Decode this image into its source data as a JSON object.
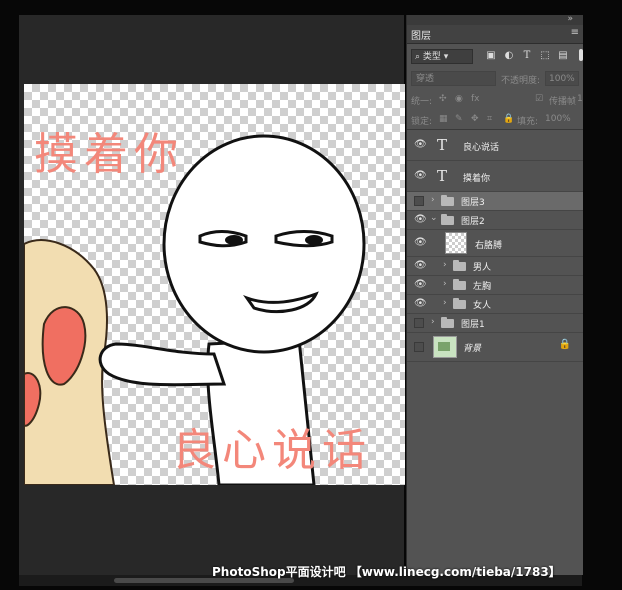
{
  "canvas": {
    "text_top": "摸着你",
    "text_bottom": "良心说话"
  },
  "layers_panel": {
    "tab_label": "图层",
    "filter_kind": "类型",
    "blend_mode": "穿透",
    "opacity_label": "不透明度:",
    "opacity_value": "100%",
    "unify_label": "统一:",
    "propagate_label": "传播帧",
    "propagate_value": "1",
    "lock_label": "锁定:",
    "fill_label": "填充:",
    "fill_value": "100%",
    "layers": [
      {
        "name": "良心说话",
        "kind": "text",
        "visible": true
      },
      {
        "name": "摸着你",
        "kind": "text",
        "visible": true
      },
      {
        "name": "图层3",
        "kind": "group",
        "visible": false,
        "selected": true
      },
      {
        "name": "图层2",
        "kind": "group",
        "visible": true,
        "expanded": true
      },
      {
        "name": "右胳膊",
        "kind": "pixel",
        "visible": true
      },
      {
        "name": "男人",
        "kind": "group",
        "visible": true
      },
      {
        "name": "左胸",
        "kind": "group",
        "visible": true
      },
      {
        "name": "女人",
        "kind": "group",
        "visible": true
      },
      {
        "name": "图层1",
        "kind": "group",
        "visible": false
      },
      {
        "name": "背景",
        "kind": "background",
        "visible": false,
        "locked": true
      }
    ]
  },
  "icons": {
    "eye": "eye-icon",
    "folder": "folder-icon",
    "text": "text-layer-icon",
    "lock": "lock-icon"
  },
  "watermark": "PhotoShop平面设计吧 【www.linecg.com/tieba/1783】",
  "colors": {
    "canvas_text": "#f3877a",
    "panel_bg": "#535353",
    "selected_layer": "#6a6a6a",
    "workspace_bg": "#282828"
  }
}
